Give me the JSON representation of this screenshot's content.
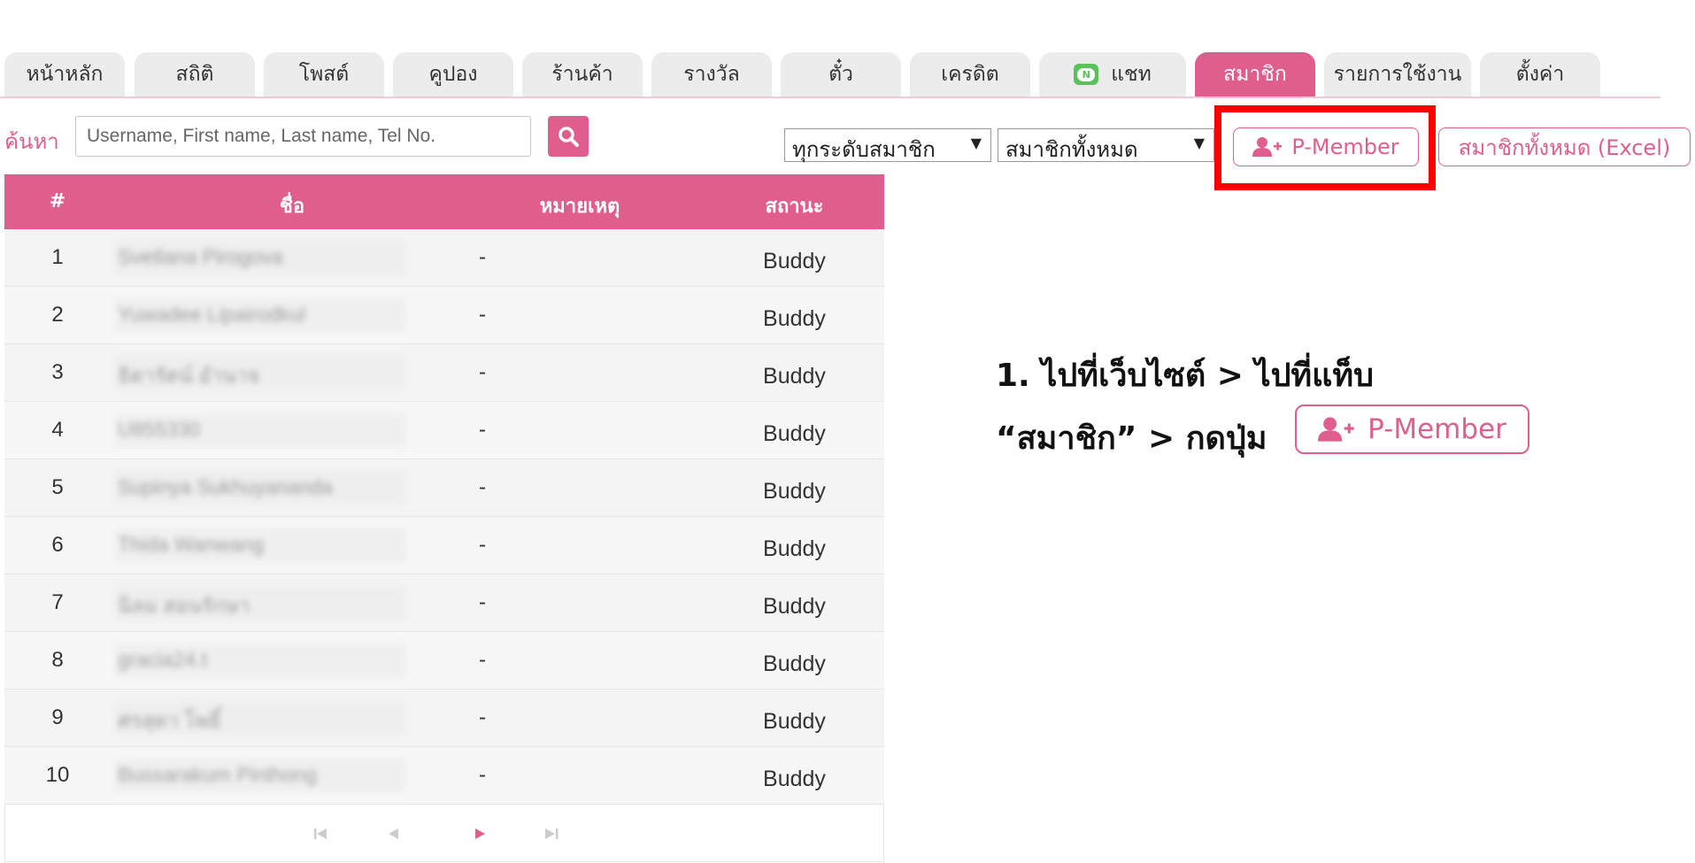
{
  "tabs": [
    {
      "label": "หน้าหลัก"
    },
    {
      "label": "สถิติ"
    },
    {
      "label": "โพสต์"
    },
    {
      "label": "คูปอง"
    },
    {
      "label": "ร้านค้า"
    },
    {
      "label": "รางวัล"
    },
    {
      "label": "ตั๋ว"
    },
    {
      "label": "เครดิต"
    },
    {
      "label": "แชท",
      "icon": "line-chat-icon"
    },
    {
      "label": "สมาชิก",
      "active": true
    },
    {
      "label": "รายการใช้งาน"
    },
    {
      "label": "ตั้งค่า"
    }
  ],
  "search": {
    "label": "ค้นหา",
    "placeholder": "Username, First name, Last name, Tel No.",
    "button_icon": "search-icon"
  },
  "filters": {
    "level": "ทุกระดับสมาชิก",
    "members": "สมาชิกทั้งหมด"
  },
  "actions": {
    "pmember_label": "P-Member",
    "pmember_icon": "add-user-icon",
    "excel_label": "สมาชิกทั้งหมด (Excel)"
  },
  "table": {
    "headers": {
      "num": "#",
      "name": "ชื่อ",
      "note": "หมายเหตุ",
      "status": "สถานะ"
    },
    "rows": [
      {
        "num": "1",
        "name": "Svetlana Pirogova",
        "note": "-",
        "status": "Buddy"
      },
      {
        "num": "2",
        "name": "Yuwadee Lipairodkul",
        "note": "-",
        "status": "Buddy"
      },
      {
        "num": "3",
        "name": "ธิดารัตน์ อำนาจ",
        "note": "-",
        "status": "Buddy"
      },
      {
        "num": "4",
        "name": "U855330",
        "note": "-",
        "status": "Buddy"
      },
      {
        "num": "5",
        "name": "Supinya Sukhuyananda",
        "note": "-",
        "status": "Buddy"
      },
      {
        "num": "6",
        "name": "Thida Wanwang",
        "note": "-",
        "status": "Buddy"
      },
      {
        "num": "7",
        "name": "นิลม สอนรักษา",
        "note": "-",
        "status": "Buddy"
      },
      {
        "num": "8",
        "name": "gracia24.t",
        "note": "-",
        "status": "Buddy"
      },
      {
        "num": "9",
        "name": "ศรสุดา โพธิ์",
        "note": "-",
        "status": "Buddy"
      },
      {
        "num": "10",
        "name": "Bussarakum Pinthong",
        "note": "-",
        "status": "Buddy"
      }
    ]
  },
  "instruction": {
    "line1": "1. ไปที่เว็บไซต์ > ไปที่แท็บ",
    "line2": "“สมาชิก” > กดปุ่ม",
    "button_label": "P-Member"
  },
  "colors": {
    "accent": "#e05e8e",
    "highlight": "#ff0000"
  }
}
